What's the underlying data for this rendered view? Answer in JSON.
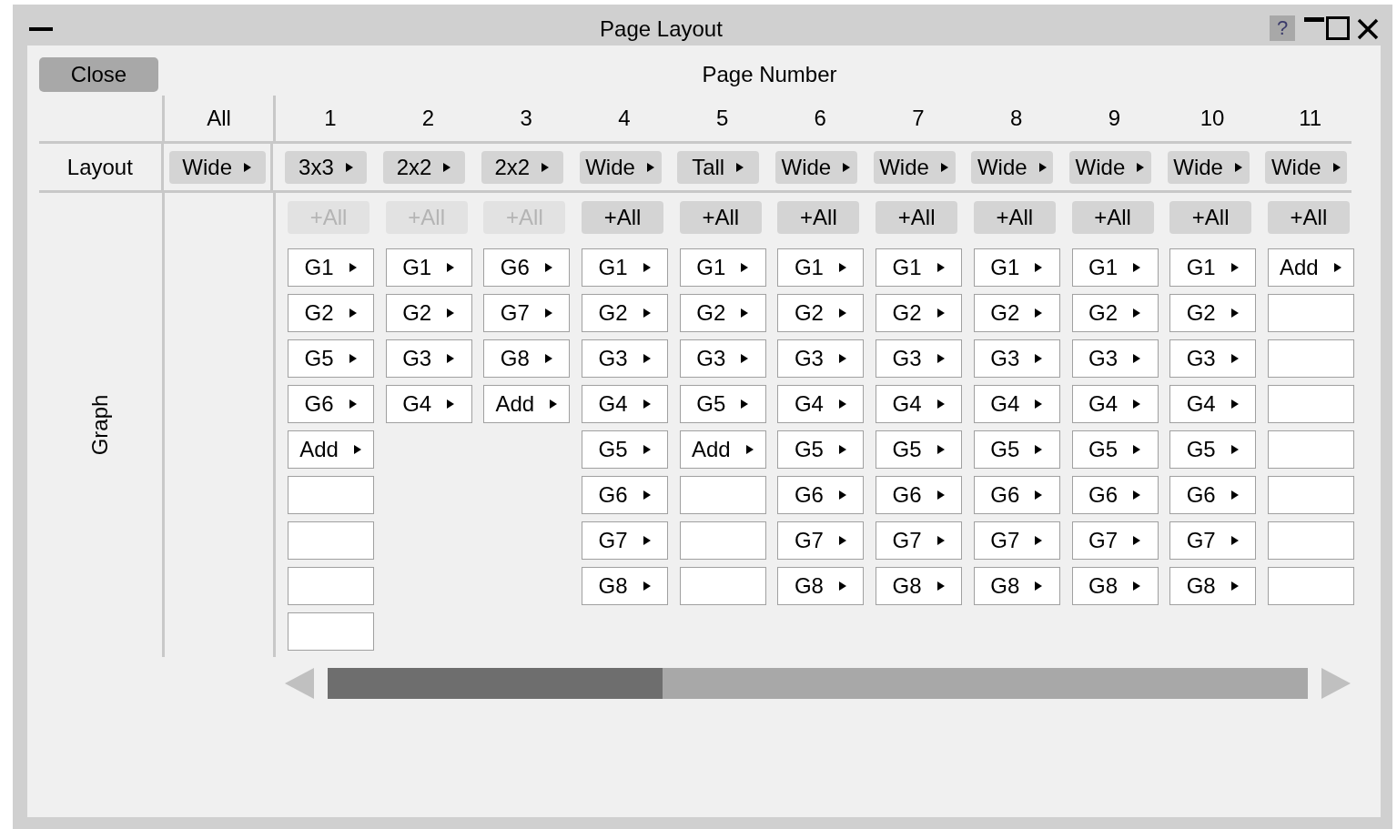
{
  "window": {
    "title": "Page Layout",
    "help": "?"
  },
  "close_button": "Close",
  "header": "Page Number",
  "all_column": {
    "heading": "All",
    "layout": "Wide"
  },
  "row_labels": {
    "layout": "Layout",
    "graph": "Graph"
  },
  "pages": [
    {
      "number": "1",
      "layout": "3x3",
      "add_all": {
        "label": "+All",
        "disabled": true
      },
      "graphs": [
        {
          "kind": "item",
          "label": "G1"
        },
        {
          "kind": "item",
          "label": "G2"
        },
        {
          "kind": "item",
          "label": "G5"
        },
        {
          "kind": "item",
          "label": "G6"
        },
        {
          "kind": "item",
          "label": "Add"
        },
        {
          "kind": "empty"
        },
        {
          "kind": "empty"
        },
        {
          "kind": "empty"
        },
        {
          "kind": "empty"
        }
      ]
    },
    {
      "number": "2",
      "layout": "2x2",
      "add_all": {
        "label": "+All",
        "disabled": true
      },
      "graphs": [
        {
          "kind": "item",
          "label": "G1"
        },
        {
          "kind": "item",
          "label": "G2"
        },
        {
          "kind": "item",
          "label": "G3"
        },
        {
          "kind": "item",
          "label": "G4"
        }
      ]
    },
    {
      "number": "3",
      "layout": "2x2",
      "add_all": {
        "label": "+All",
        "disabled": true
      },
      "graphs": [
        {
          "kind": "item",
          "label": "G6"
        },
        {
          "kind": "item",
          "label": "G7"
        },
        {
          "kind": "item",
          "label": "G8"
        },
        {
          "kind": "item",
          "label": "Add"
        }
      ]
    },
    {
      "number": "4",
      "layout": "Wide",
      "add_all": {
        "label": "+All",
        "disabled": false
      },
      "graphs": [
        {
          "kind": "item",
          "label": "G1"
        },
        {
          "kind": "item",
          "label": "G2"
        },
        {
          "kind": "item",
          "label": "G3"
        },
        {
          "kind": "item",
          "label": "G4"
        },
        {
          "kind": "item",
          "label": "G5"
        },
        {
          "kind": "item",
          "label": "G6"
        },
        {
          "kind": "item",
          "label": "G7"
        },
        {
          "kind": "item",
          "label": "G8"
        }
      ]
    },
    {
      "number": "5",
      "layout": "Tall",
      "add_all": {
        "label": "+All",
        "disabled": false
      },
      "graphs": [
        {
          "kind": "item",
          "label": "G1"
        },
        {
          "kind": "item",
          "label": "G2"
        },
        {
          "kind": "item",
          "label": "G3"
        },
        {
          "kind": "item",
          "label": "G5"
        },
        {
          "kind": "item",
          "label": "Add"
        },
        {
          "kind": "empty"
        },
        {
          "kind": "empty"
        },
        {
          "kind": "empty"
        }
      ]
    },
    {
      "number": "6",
      "layout": "Wide",
      "add_all": {
        "label": "+All",
        "disabled": false
      },
      "graphs": [
        {
          "kind": "item",
          "label": "G1"
        },
        {
          "kind": "item",
          "label": "G2"
        },
        {
          "kind": "item",
          "label": "G3"
        },
        {
          "kind": "item",
          "label": "G4"
        },
        {
          "kind": "item",
          "label": "G5"
        },
        {
          "kind": "item",
          "label": "G6"
        },
        {
          "kind": "item",
          "label": "G7"
        },
        {
          "kind": "item",
          "label": "G8"
        }
      ]
    },
    {
      "number": "7",
      "layout": "Wide",
      "add_all": {
        "label": "+All",
        "disabled": false
      },
      "graphs": [
        {
          "kind": "item",
          "label": "G1"
        },
        {
          "kind": "item",
          "label": "G2"
        },
        {
          "kind": "item",
          "label": "G3"
        },
        {
          "kind": "item",
          "label": "G4"
        },
        {
          "kind": "item",
          "label": "G5"
        },
        {
          "kind": "item",
          "label": "G6"
        },
        {
          "kind": "item",
          "label": "G7"
        },
        {
          "kind": "item",
          "label": "G8"
        }
      ]
    },
    {
      "number": "8",
      "layout": "Wide",
      "add_all": {
        "label": "+All",
        "disabled": false
      },
      "graphs": [
        {
          "kind": "item",
          "label": "G1"
        },
        {
          "kind": "item",
          "label": "G2"
        },
        {
          "kind": "item",
          "label": "G3"
        },
        {
          "kind": "item",
          "label": "G4"
        },
        {
          "kind": "item",
          "label": "G5"
        },
        {
          "kind": "item",
          "label": "G6"
        },
        {
          "kind": "item",
          "label": "G7"
        },
        {
          "kind": "item",
          "label": "G8"
        }
      ]
    },
    {
      "number": "9",
      "layout": "Wide",
      "add_all": {
        "label": "+All",
        "disabled": false
      },
      "graphs": [
        {
          "kind": "item",
          "label": "G1"
        },
        {
          "kind": "item",
          "label": "G2"
        },
        {
          "kind": "item",
          "label": "G3"
        },
        {
          "kind": "item",
          "label": "G4"
        },
        {
          "kind": "item",
          "label": "G5"
        },
        {
          "kind": "item",
          "label": "G6"
        },
        {
          "kind": "item",
          "label": "G7"
        },
        {
          "kind": "item",
          "label": "G8"
        }
      ]
    },
    {
      "number": "10",
      "layout": "Wide",
      "add_all": {
        "label": "+All",
        "disabled": false
      },
      "graphs": [
        {
          "kind": "item",
          "label": "G1"
        },
        {
          "kind": "item",
          "label": "G2"
        },
        {
          "kind": "item",
          "label": "G3"
        },
        {
          "kind": "item",
          "label": "G4"
        },
        {
          "kind": "item",
          "label": "G5"
        },
        {
          "kind": "item",
          "label": "G6"
        },
        {
          "kind": "item",
          "label": "G7"
        },
        {
          "kind": "item",
          "label": "G8"
        }
      ]
    },
    {
      "number": "11",
      "layout": "Wide",
      "add_all": {
        "label": "+All",
        "disabled": false
      },
      "graphs": [
        {
          "kind": "item",
          "label": "Add"
        },
        {
          "kind": "empty"
        },
        {
          "kind": "empty"
        },
        {
          "kind": "empty"
        },
        {
          "kind": "empty"
        },
        {
          "kind": "empty"
        },
        {
          "kind": "empty"
        },
        {
          "kind": "empty"
        }
      ]
    }
  ]
}
